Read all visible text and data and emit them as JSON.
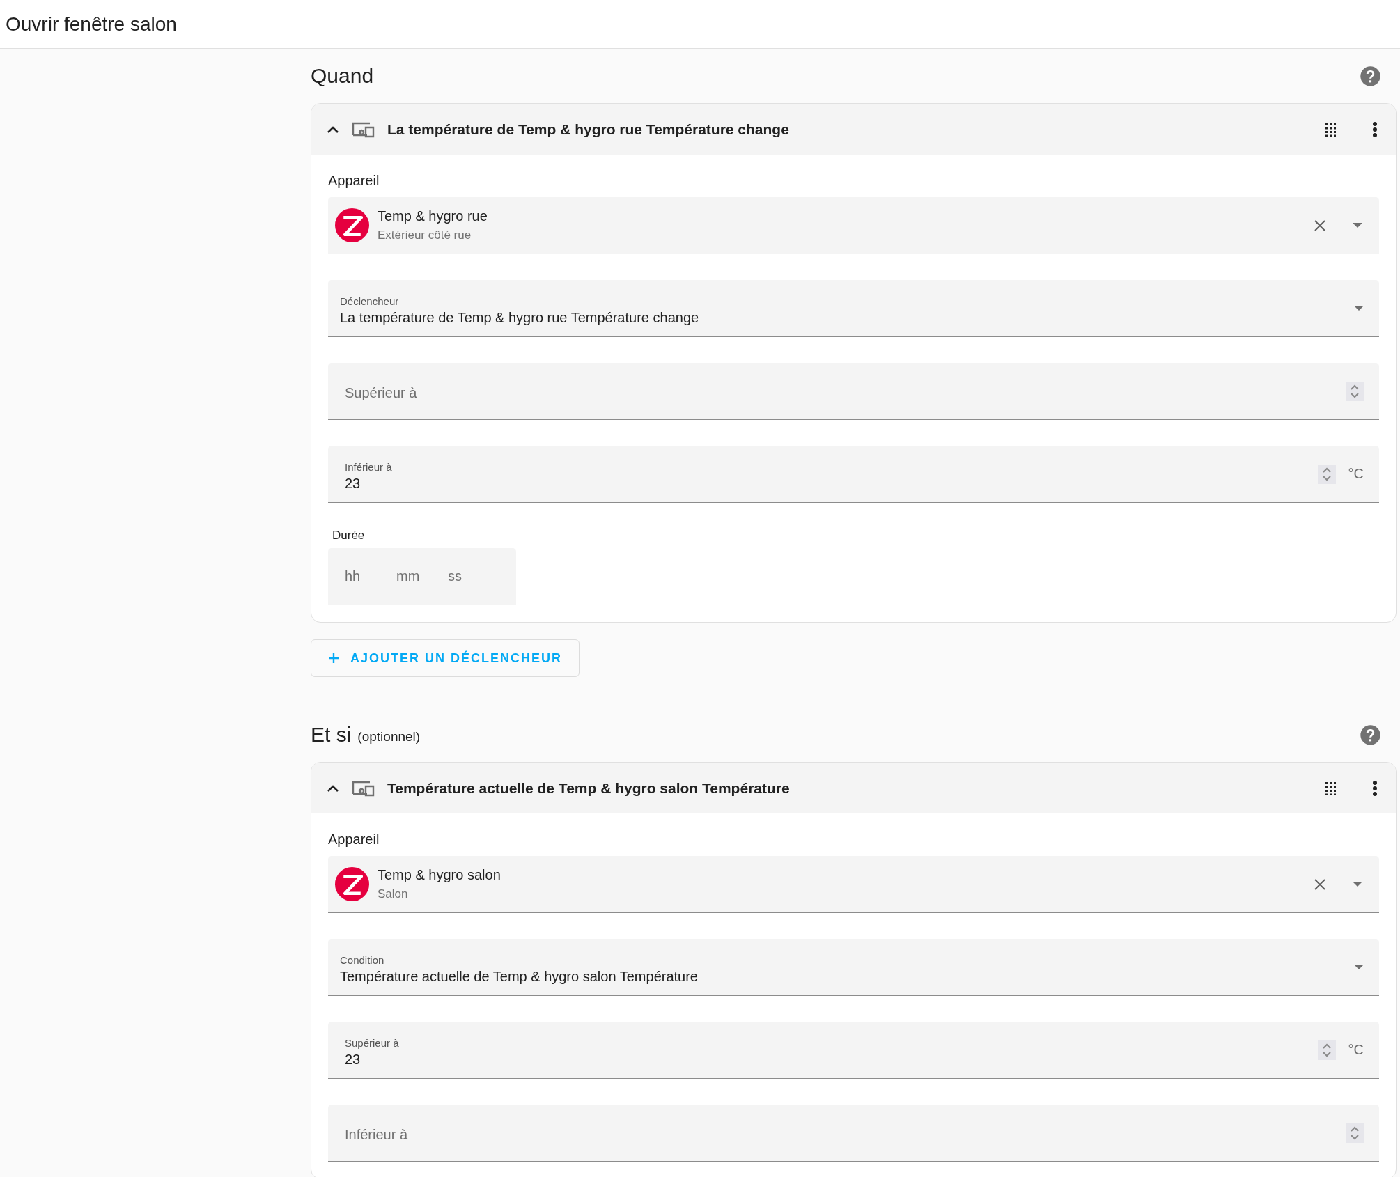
{
  "page_title": "Ouvrir fenêtre salon",
  "sections": [
    {
      "heading": "Quand",
      "cards": [
        {
          "title": "La température de Temp & hygro rue Température change",
          "expanded": true,
          "fields": [
            {
              "kind": "device",
              "label": "Appareil",
              "name": "Temp & hygro rue",
              "area": "Extérieur côté rue"
            },
            {
              "kind": "select",
              "label": "Déclencheur",
              "value": "La température de Temp & hygro rue Température change"
            },
            {
              "kind": "number",
              "label": "Supérieur à"
            },
            {
              "kind": "number",
              "label": "Inférieur à",
              "value": "23",
              "unit": "°C"
            },
            {
              "kind": "duration",
              "label": "Durée",
              "parts": [
                "hh",
                "mm",
                "ss"
              ]
            }
          ]
        }
      ],
      "add_button": "AJOUTER UN DÉCLENCHEUR"
    },
    {
      "heading": "Et si",
      "subheading": "(optionnel)",
      "cards": [
        {
          "title": "Température actuelle de Temp & hygro salon Température",
          "expanded": true,
          "fields": [
            {
              "kind": "device",
              "label": "Appareil",
              "name": "Temp & hygro salon",
              "area": "Salon"
            },
            {
              "kind": "select",
              "label": "Condition",
              "value": "Température actuelle de Temp & hygro salon Température"
            },
            {
              "kind": "number",
              "label": "Supérieur à",
              "value": "23",
              "unit": "°C"
            },
            {
              "kind": "number",
              "label": "Inférieur à"
            }
          ]
        }
      ]
    }
  ]
}
